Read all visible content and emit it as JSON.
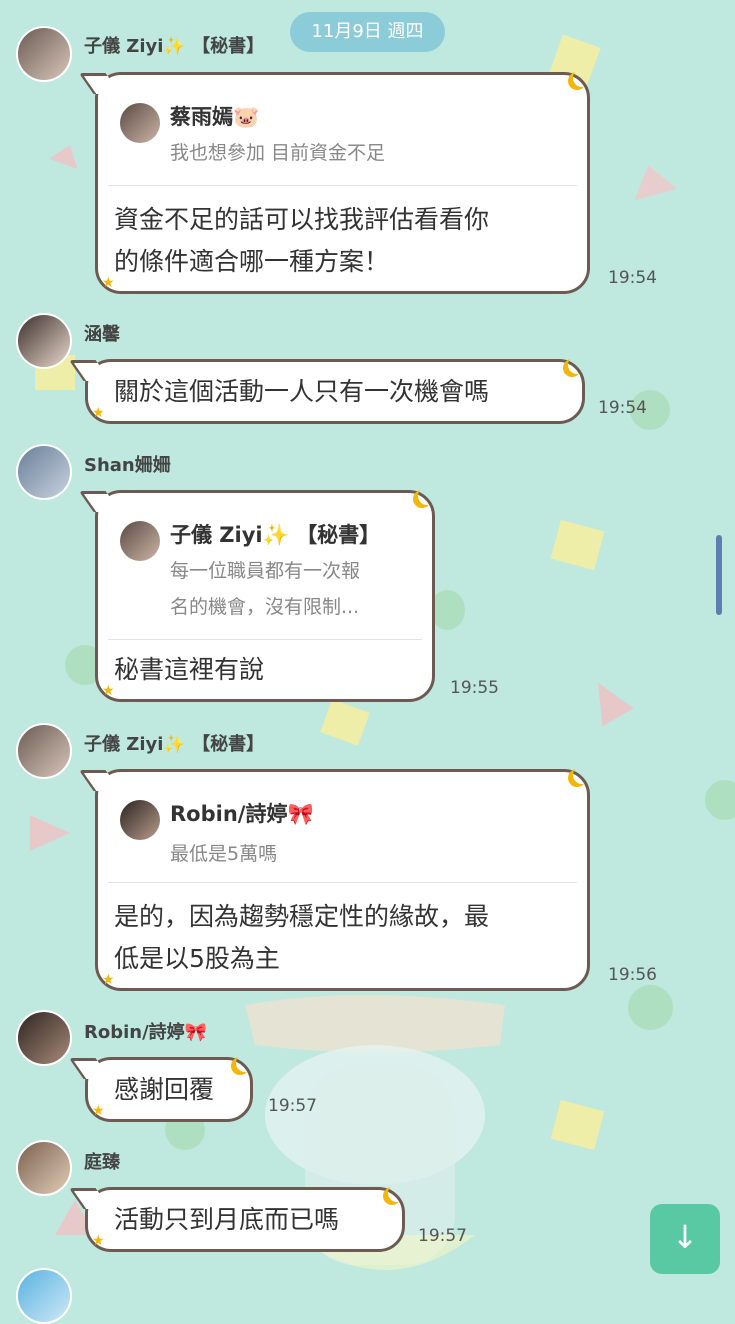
{
  "date_chip": "11月9日 週四",
  "messages": [
    {
      "sender": "子儀 Ziyi✨ 【秘書】",
      "reply_name": "蔡雨嫣🐷",
      "reply_text": "我也想參加 目前資金不足",
      "text_lines": [
        "資金不足的話可以找我評估看看你",
        "的條件適合哪一種方案！"
      ],
      "time": "19:54"
    },
    {
      "sender": "涵馨",
      "text_lines": [
        "關於這個活動一人只有一次機會嗎"
      ],
      "time": "19:54"
    },
    {
      "sender": "Shan姍姍",
      "reply_name": "子儀 Ziyi✨ 【秘書】",
      "reply_text_lines": [
        "每一位職員都有一次報",
        "名的機會，沒有限制..."
      ],
      "text_lines": [
        "秘書這裡有說"
      ],
      "time": "19:55"
    },
    {
      "sender": "子儀 Ziyi✨ 【秘書】",
      "reply_name": "Robin/詩婷🎀",
      "reply_text": "最低是5萬嗎",
      "text_lines": [
        "是的，因為趨勢穩定性的緣故，最",
        "低是以5股為主"
      ],
      "time": "19:56"
    },
    {
      "sender": "Robin/詩婷🎀",
      "text_lines": [
        "感謝回覆"
      ],
      "time": "19:57"
    },
    {
      "sender": "庭臻",
      "text_lines": [
        "活動只到月底而已嗎"
      ],
      "time": "19:57"
    }
  ],
  "scroll_down_icon": "arrow-down-icon",
  "colors": {
    "background": "#bfe8df",
    "bubble_border": "#6d5b53",
    "date_chip": "#8cccd9",
    "scroll_button": "#58c9a2"
  }
}
